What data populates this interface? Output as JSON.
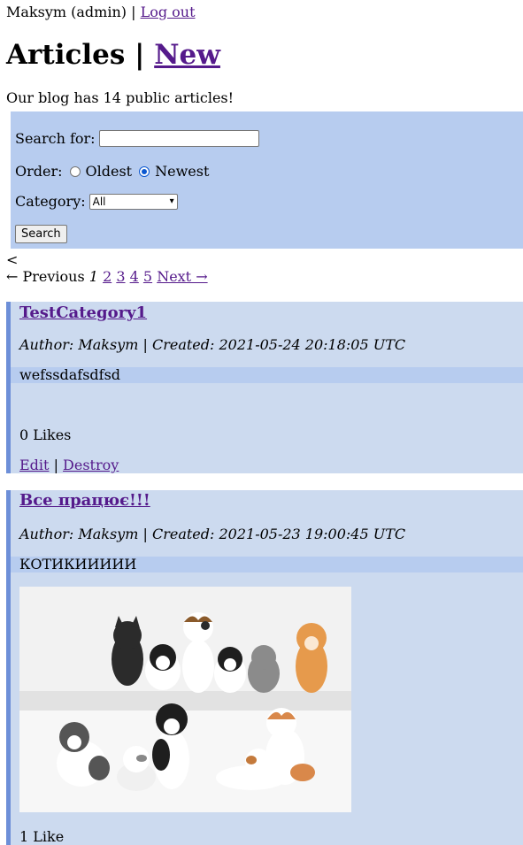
{
  "user": {
    "name": "Maksym (admin)",
    "separator": "|",
    "logout": "Log out"
  },
  "header": {
    "title": "Articles",
    "separator": "|",
    "new_link": "New"
  },
  "summary": "Our blog has 14 public articles!",
  "search": {
    "search_label": "Search for:",
    "search_value": "",
    "search_placeholder": "",
    "order_label": "Order:",
    "order_options": [
      "Oldest",
      "Newest"
    ],
    "order_selected": "Newest",
    "category_label": "Category:",
    "category_selected": "All",
    "submit_label": "Search"
  },
  "pagination": {
    "stray": "<",
    "previous": "← Previous",
    "current": "1",
    "pages": [
      "2",
      "3",
      "4",
      "5"
    ],
    "next": "Next →"
  },
  "articles": [
    {
      "title": "TestCategory1",
      "meta": "Author: Maksym | Created: 2021-05-24 20:18:05 UTC",
      "body": "wefssdafsdfsd",
      "likes": "0 Likes",
      "edit": "Edit",
      "separator": "|",
      "destroy": "Destroy"
    },
    {
      "title": "Все працює!!!",
      "meta": "Author: Maksym | Created: 2021-05-23 19:00:45 UTC",
      "body": "КОТИКИИИИИ",
      "likes": "1 Like"
    }
  ],
  "colors": {
    "panel": "#b7ccef",
    "card": "#ccdaef",
    "card_border": "#6d8fd8",
    "link": "#551a8b"
  }
}
